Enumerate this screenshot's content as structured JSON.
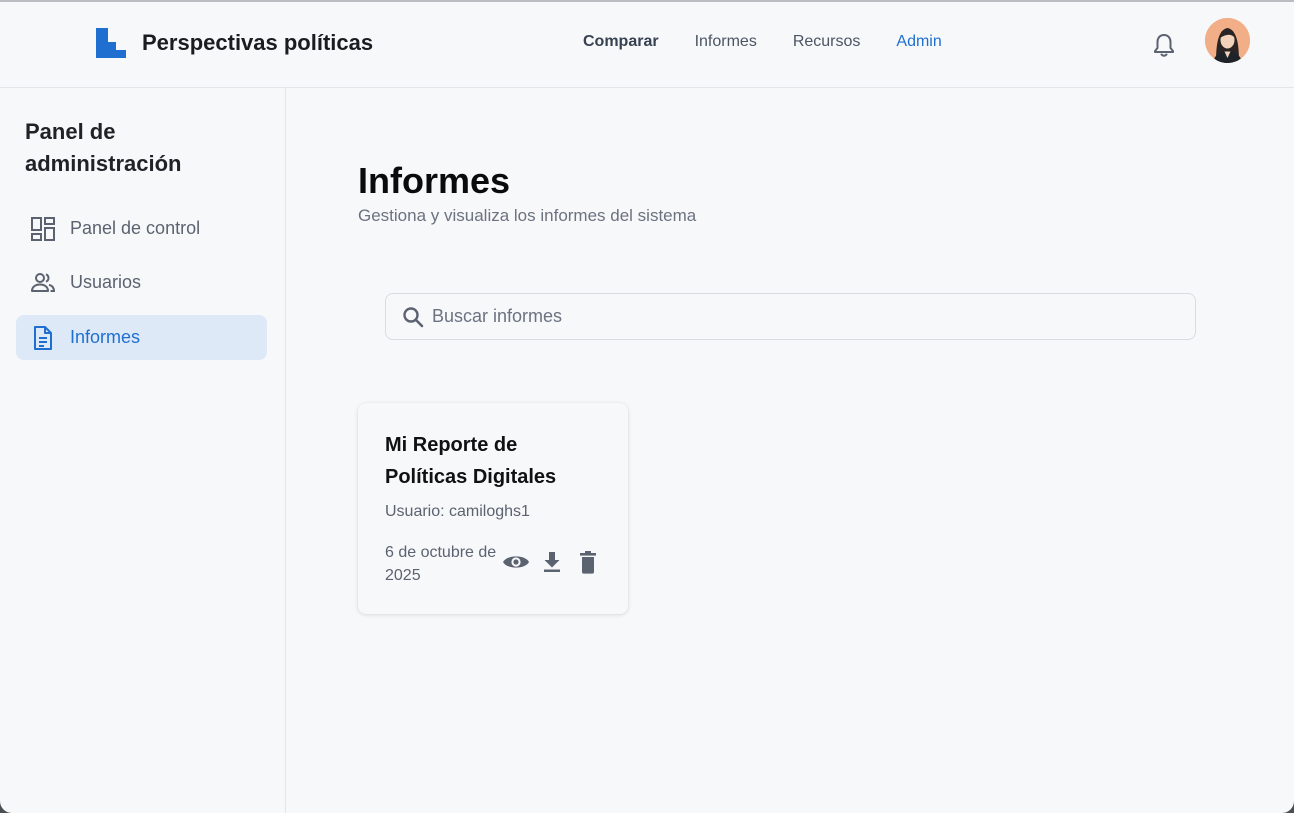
{
  "header": {
    "brand_name": "Perspectivas políticas",
    "nav": [
      {
        "label": "Comparar"
      },
      {
        "label": "Informes"
      },
      {
        "label": "Recursos"
      },
      {
        "label": "Admin"
      }
    ],
    "icons": {
      "brand": "brand-logo-icon",
      "notifications": "bell-icon",
      "avatar": "user-avatar"
    }
  },
  "sidebar": {
    "title": "Panel de administración",
    "items": [
      {
        "label": "Panel de control",
        "icon": "dashboard-icon"
      },
      {
        "label": "Usuarios",
        "icon": "users-icon"
      },
      {
        "label": "Informes",
        "icon": "document-icon",
        "active": true
      }
    ]
  },
  "main": {
    "title": "Informes",
    "subtitle": "Gestiona y visualiza los informes del sistema",
    "search": {
      "placeholder": "Buscar informes",
      "value": ""
    }
  },
  "reports": [
    {
      "title": "Mi Reporte de Políticas Digitales",
      "user": "Usuario: camiloghs1",
      "date": "6 de octubre de 2025",
      "actions": [
        "view-icon",
        "download-icon",
        "delete-icon"
      ]
    }
  ],
  "colors": {
    "accent": "#1f6fd1",
    "active_bg": "#dde9f6",
    "background": "#f7f8fa",
    "muted_text": "#5b6270"
  }
}
